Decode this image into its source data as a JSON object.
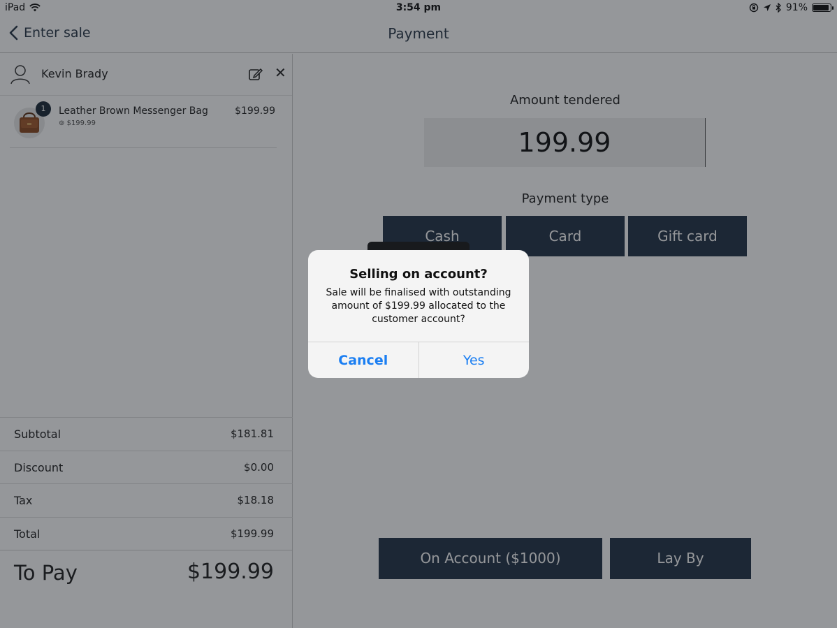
{
  "status_bar": {
    "device": "iPad",
    "time": "3:54 pm",
    "battery_text": "91%",
    "battery_level": 0.91,
    "icons": [
      "wifi-icon",
      "orientation-lock-icon",
      "location-icon",
      "bluetooth-icon",
      "battery-icon"
    ]
  },
  "nav": {
    "back_label": "Enter sale",
    "title": "Payment"
  },
  "customer": {
    "name": "Kevin Brady"
  },
  "line_items": [
    {
      "name": "Leather Brown Messenger Bag",
      "qty": "1",
      "unit_price": "$199.99",
      "price": "$199.99"
    }
  ],
  "totals": {
    "subtotal_label": "Subtotal",
    "subtotal": "$181.81",
    "discount_label": "Discount",
    "discount": "$0.00",
    "tax_label": "Tax",
    "tax": "$18.18",
    "total_label": "Total",
    "total": "$199.99",
    "topay_label": "To Pay",
    "topay": "$199.99"
  },
  "payment": {
    "amount_label": "Amount tendered",
    "amount": "199.99",
    "type_label": "Payment type",
    "types": [
      "Cash",
      "Card",
      "Gift card"
    ],
    "on_account": "On Account ($1000)",
    "lay_by": "Lay By"
  },
  "dialog": {
    "title": "Selling on account?",
    "message": "Sale will be finalised with outstanding amount of $199.99 allocated to the customer account?",
    "cancel": "Cancel",
    "confirm": "Yes"
  },
  "colors": {
    "button_bg": "#243447",
    "dialog_action": "#1a7ef2",
    "overlay": "rgba(20,24,30,0.45)"
  }
}
